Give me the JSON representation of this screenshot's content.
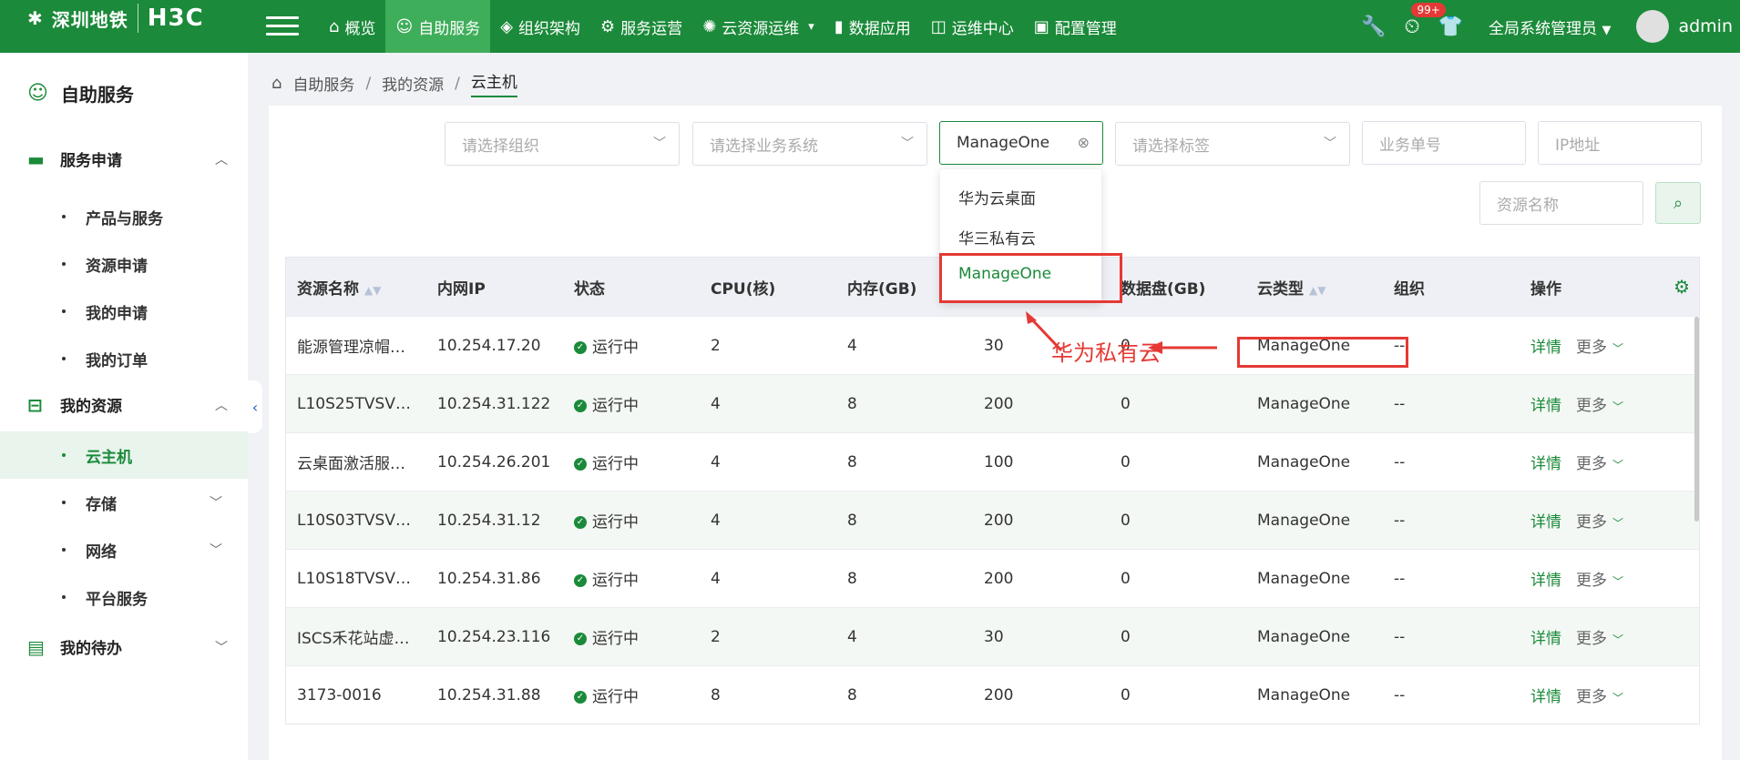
{
  "header": {
    "logo_cn": "深圳地铁",
    "logo_brand": "H3C",
    "nav": [
      {
        "label": "概览",
        "icon": "home-icon"
      },
      {
        "label": "自助服务",
        "icon": "self-service-icon"
      },
      {
        "label": "组织架构",
        "icon": "layers-icon"
      },
      {
        "label": "服务运营",
        "icon": "gear-icon"
      },
      {
        "label": "云资源运维",
        "icon": "cloud-ops-icon"
      },
      {
        "label": "数据应用",
        "icon": "bar-chart-icon"
      },
      {
        "label": "运维中心",
        "icon": "line-chart-icon"
      },
      {
        "label": "配置管理",
        "icon": "monitor-icon"
      }
    ],
    "badge": "99+",
    "role": "全局系统管理员",
    "user": "admin"
  },
  "sidebar": {
    "title": "自助服务",
    "groups": {
      "service_request": "服务申请",
      "my_resources": "我的资源",
      "my_todo": "我的待办"
    },
    "items": {
      "products": "产品与服务",
      "resource_apply": "资源申请",
      "my_apply": "我的申请",
      "my_orders": "我的订单",
      "cloud_host": "云主机",
      "storage": "存储",
      "network": "网络",
      "platform": "平台服务"
    }
  },
  "breadcrumb": [
    "自助服务",
    "我的资源",
    "云主机"
  ],
  "filters": {
    "org_placeholder": "请选择组织",
    "biz_placeholder": "请选择业务系统",
    "cloud_value": "ManageOne",
    "tag_placeholder": "请选择标签",
    "order_placeholder": "业务单号",
    "ip_placeholder": "IP地址",
    "name_placeholder": "资源名称"
  },
  "dropdown": {
    "options": [
      "华为云桌面",
      "华三私有云",
      "ManageOne"
    ],
    "selected": "ManageOne"
  },
  "table": {
    "headers": [
      "资源名称",
      "内网IP",
      "状态",
      "CPU(核)",
      "内存(GB)",
      "",
      "数据盘(GB)",
      "云类型",
      "组织",
      "操作"
    ],
    "rows": [
      [
        "能源管理凉帽…",
        "10.254.17.20",
        "运行中",
        "2",
        "4",
        "30",
        "0",
        "ManageOne",
        "--"
      ],
      [
        "L10S25TVSV…",
        "10.254.31.122",
        "运行中",
        "4",
        "8",
        "200",
        "0",
        "ManageOne",
        "--"
      ],
      [
        "云桌面激活服…",
        "10.254.26.201",
        "运行中",
        "4",
        "8",
        "100",
        "0",
        "ManageOne",
        "--"
      ],
      [
        "L10S03TVSV…",
        "10.254.31.12",
        "运行中",
        "4",
        "8",
        "200",
        "0",
        "ManageOne",
        "--"
      ],
      [
        "L10S18TVSV…",
        "10.254.31.86",
        "运行中",
        "4",
        "8",
        "200",
        "0",
        "ManageOne",
        "--"
      ],
      [
        "ISCS禾花站虚…",
        "10.254.23.116",
        "运行中",
        "2",
        "4",
        "30",
        "0",
        "ManageOne",
        "--"
      ],
      [
        "3173-0016",
        "10.254.31.88",
        "运行中",
        "8",
        "8",
        "200",
        "0",
        "ManageOne",
        "--"
      ]
    ],
    "op_detail": "详情",
    "op_more": "更多"
  },
  "annotation": {
    "text": "华为私有云",
    "color": "#e53935"
  },
  "colors": {
    "primary": "#1b8a3a",
    "active_nav": "#3fae5a"
  }
}
